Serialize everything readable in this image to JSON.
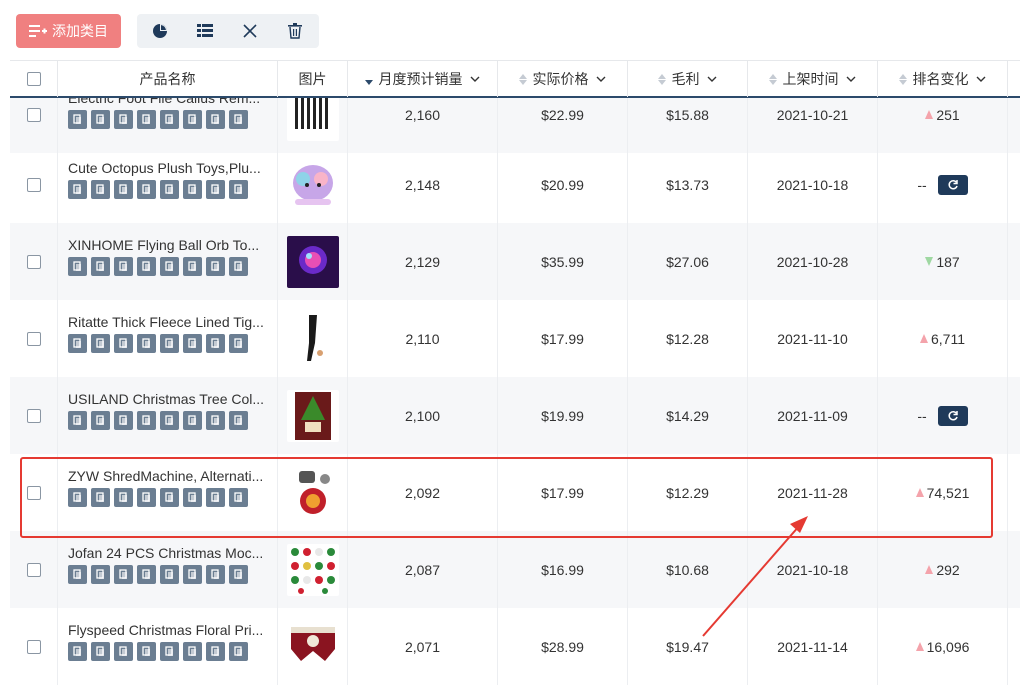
{
  "toolbar": {
    "add_label": "添加类目",
    "tools": [
      "pie-chart-icon",
      "list-icon",
      "close-icon",
      "trash-icon"
    ]
  },
  "columns": {
    "name": "产品名称",
    "image": "图片",
    "sales": "月度预计销量",
    "price": "实际价格",
    "margin": "毛利",
    "listed": "上架时间",
    "rank": "排名变化"
  },
  "rows": [
    {
      "name": "Electric Foot File Callus Rem...",
      "sales": "2,160",
      "price": "$22.99",
      "margin": "$15.88",
      "listed": "2021-10-21",
      "rank": "251",
      "trend": "up",
      "thumb": "brushes"
    },
    {
      "name": "Cute Octopus Plush Toys,Plu...",
      "sales": "2,148",
      "price": "$20.99",
      "margin": "$13.73",
      "listed": "2021-10-18",
      "rank": "--",
      "trend": "none",
      "thumb": "plush"
    },
    {
      "name": "XINHOME Flying Ball Orb To...",
      "sales": "2,129",
      "price": "$35.99",
      "margin": "$27.06",
      "listed": "2021-10-28",
      "rank": "187",
      "trend": "down",
      "thumb": "orb"
    },
    {
      "name": "Ritatte Thick Fleece Lined Tig...",
      "sales": "2,110",
      "price": "$17.99",
      "margin": "$12.28",
      "listed": "2021-11-10",
      "rank": "6,711",
      "trend": "up",
      "thumb": "tights"
    },
    {
      "name": "USILAND Christmas Tree Col...",
      "sales": "2,100",
      "price": "$19.99",
      "margin": "$14.29",
      "listed": "2021-11-09",
      "rank": "--",
      "trend": "none",
      "thumb": "tree"
    },
    {
      "name": "ZYW ShredMachine, Alternati...",
      "sales": "2,092",
      "price": "$17.99",
      "margin": "$12.29",
      "listed": "2021-11-28",
      "rank": "74,521",
      "trend": "up",
      "thumb": "machine"
    },
    {
      "name": "Jofan 24 PCS Christmas Moc...",
      "sales": "2,087",
      "price": "$16.99",
      "margin": "$10.68",
      "listed": "2021-10-18",
      "rank": "292",
      "trend": "up",
      "thumb": "ornaments"
    },
    {
      "name": "Flyspeed Christmas Floral Pri...",
      "sales": "2,071",
      "price": "$28.99",
      "margin": "$19.47",
      "listed": "2021-11-14",
      "rank": "16,096",
      "trend": "up",
      "thumb": "runner"
    }
  ],
  "colors": {
    "accent": "#f08080",
    "header_border": "#2c4a6b",
    "icon_bg": "#6b7e92",
    "highlight": "#e53a32",
    "rank_up": "#f4a3ab",
    "rank_down": "#9fd8a2"
  }
}
